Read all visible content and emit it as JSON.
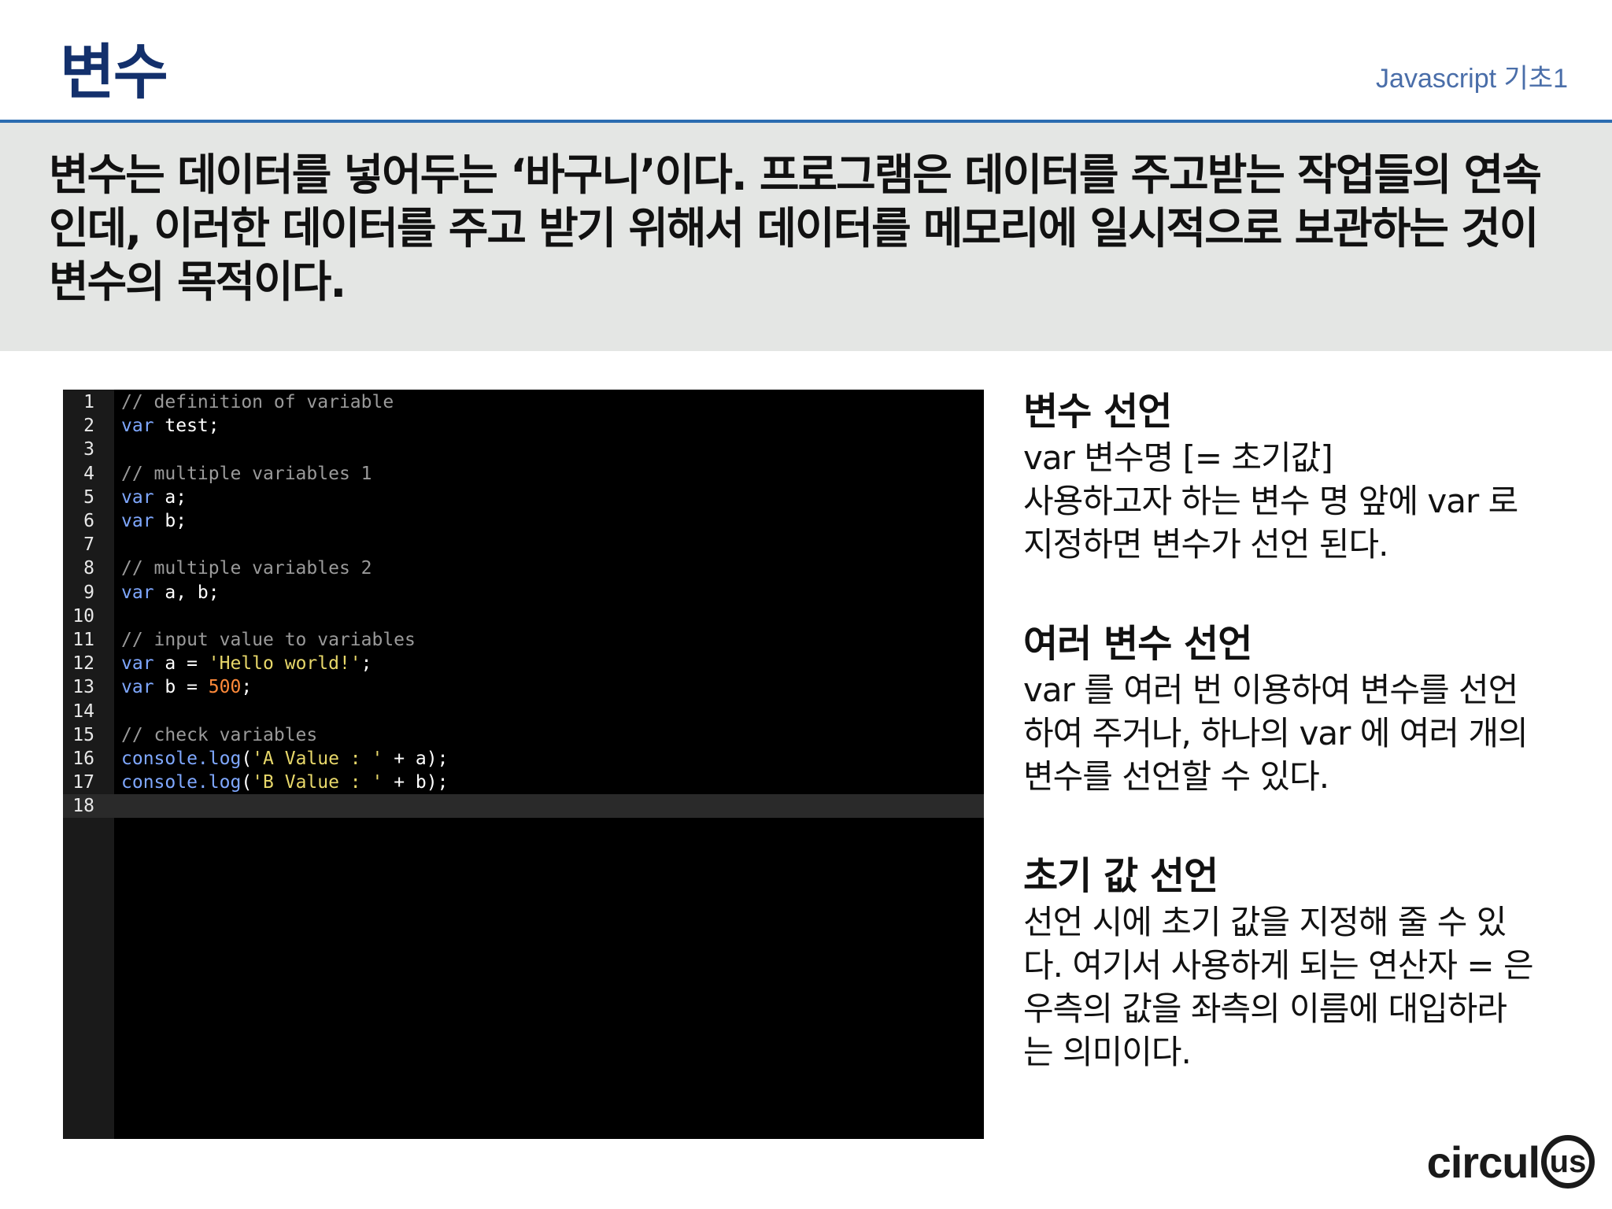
{
  "header": {
    "title": "변수",
    "course": "Javascript 기초1"
  },
  "summary": {
    "text": "변수는 데이터를 넣어두는 ‘바구니’이다. 프로그램은 데이터를 주고받는 작업들의 연속인데, 이러한 데이터를 주고 받기 위해서 데이터를 메모리에 일시적으로 보관하는 것이 변수의 목적이다."
  },
  "code": {
    "lines": [
      {
        "number": "1",
        "tokens": [
          {
            "type": "comment",
            "text": "// definition of variable"
          }
        ]
      },
      {
        "number": "2",
        "tokens": [
          {
            "type": "keyword",
            "text": "var"
          },
          {
            "type": "ident",
            "text": " test;"
          }
        ]
      },
      {
        "number": "3",
        "tokens": []
      },
      {
        "number": "4",
        "tokens": [
          {
            "type": "comment",
            "text": "// multiple variables 1"
          }
        ]
      },
      {
        "number": "5",
        "tokens": [
          {
            "type": "keyword",
            "text": "var"
          },
          {
            "type": "ident",
            "text": " a;"
          }
        ]
      },
      {
        "number": "6",
        "tokens": [
          {
            "type": "keyword",
            "text": "var"
          },
          {
            "type": "ident",
            "text": " b;"
          }
        ]
      },
      {
        "number": "7",
        "tokens": []
      },
      {
        "number": "8",
        "tokens": [
          {
            "type": "comment",
            "text": "// multiple variables 2"
          }
        ]
      },
      {
        "number": "9",
        "tokens": [
          {
            "type": "keyword",
            "text": "var"
          },
          {
            "type": "ident",
            "text": " a, b;"
          }
        ]
      },
      {
        "number": "10",
        "tokens": []
      },
      {
        "number": "11",
        "tokens": [
          {
            "type": "comment",
            "text": "// input value to variables"
          }
        ]
      },
      {
        "number": "12",
        "tokens": [
          {
            "type": "keyword",
            "text": "var"
          },
          {
            "type": "ident",
            "text": " a = "
          },
          {
            "type": "string",
            "text": "'Hello world!'"
          },
          {
            "type": "punct",
            "text": ";"
          }
        ]
      },
      {
        "number": "13",
        "tokens": [
          {
            "type": "keyword",
            "text": "var"
          },
          {
            "type": "ident",
            "text": " b = "
          },
          {
            "type": "number",
            "text": "500"
          },
          {
            "type": "punct",
            "text": ";"
          }
        ]
      },
      {
        "number": "14",
        "tokens": []
      },
      {
        "number": "15",
        "tokens": [
          {
            "type": "comment",
            "text": "// check variables"
          }
        ]
      },
      {
        "number": "16",
        "tokens": [
          {
            "type": "method",
            "text": "console.log"
          },
          {
            "type": "punct",
            "text": "("
          },
          {
            "type": "string",
            "text": "'A Value : '"
          },
          {
            "type": "ident",
            "text": " + a);"
          }
        ]
      },
      {
        "number": "17",
        "tokens": [
          {
            "type": "method",
            "text": "console.log"
          },
          {
            "type": "punct",
            "text": "("
          },
          {
            "type": "string",
            "text": "'B Value : '"
          },
          {
            "type": "ident",
            "text": " + b);"
          }
        ]
      },
      {
        "number": "18",
        "tokens": [],
        "current": true
      }
    ]
  },
  "notes": [
    {
      "heading": "변수 선언",
      "lines": [
        "var 변수명 [= 초기값]",
        "사용하고자 하는 변수 명 앞에 var 로",
        "지정하면 변수가 선언 된다."
      ]
    },
    {
      "heading": "여러 변수 선언",
      "lines": [
        "var 를 여러 번 이용하여 변수를 선언",
        "하여 주거나, 하나의 var 에 여러 개의",
        "변수를 선언할 수 있다."
      ]
    },
    {
      "heading": "초기 값 선언",
      "lines": [
        "선언 시에 초기 값을 지정해 줄 수 있",
        "다. 여기서 사용하게 되는 연산자 = 은",
        "우측의 값을 좌측의 이름에 대입하라",
        "는 의미이다."
      ]
    }
  ],
  "brand": {
    "word": "circul",
    "mark": "us"
  }
}
